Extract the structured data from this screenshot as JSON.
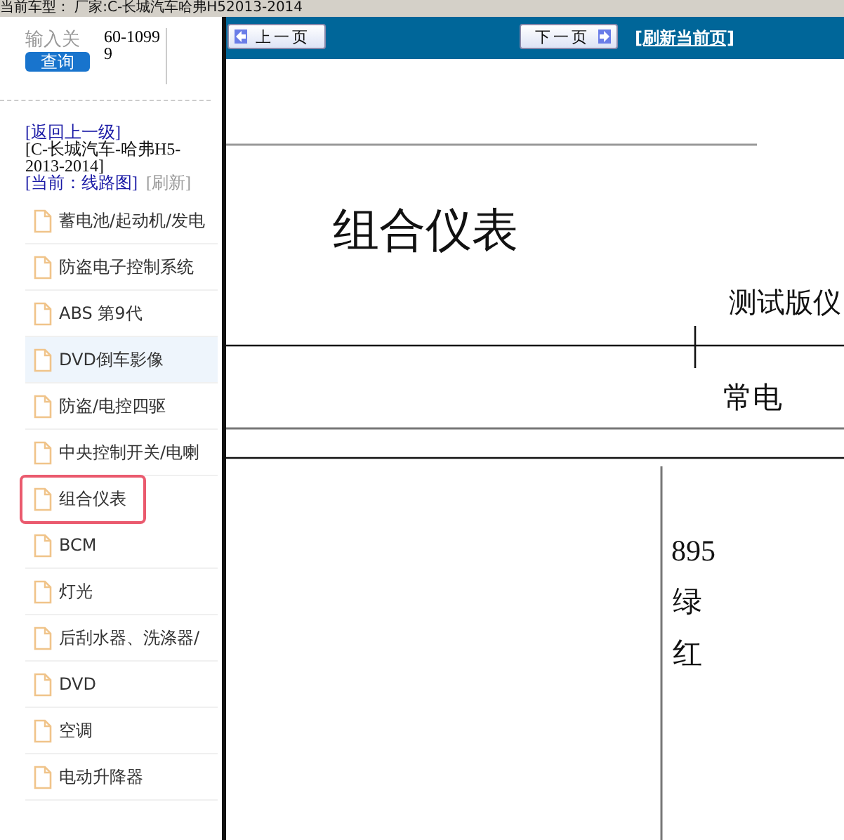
{
  "top_bar": {
    "text": "当前车型：  厂家:C-长城汽车哈弗H52013-2014"
  },
  "search": {
    "placeholder": "输入关",
    "value": "60-10999",
    "button": "查询"
  },
  "breadcrumb": {
    "back": "[返回上一级]",
    "model": "[C-长城汽车-哈弗H5-2013-2014]",
    "current": "[当前：线路图]",
    "refresh": "[刷新]"
  },
  "sidebar": {
    "items": [
      {
        "label": "蓄电池/起动机/发电",
        "selected": false,
        "outlined": false
      },
      {
        "label": "防盗电子控制系统",
        "selected": false,
        "outlined": false
      },
      {
        "label": "ABS 第9代",
        "selected": false,
        "outlined": false
      },
      {
        "label": "DVD倒车影像",
        "selected": true,
        "outlined": false
      },
      {
        "label": "防盗/电控四驱",
        "selected": false,
        "outlined": false
      },
      {
        "label": "中央控制开关/电喇",
        "selected": false,
        "outlined": false
      },
      {
        "label": "组合仪表",
        "selected": false,
        "outlined": true
      },
      {
        "label": "BCM",
        "selected": false,
        "outlined": false
      },
      {
        "label": "灯光",
        "selected": false,
        "outlined": false
      },
      {
        "label": "后刮水器、洗涤器/",
        "selected": false,
        "outlined": false
      },
      {
        "label": "DVD",
        "selected": false,
        "outlined": false
      },
      {
        "label": "空调",
        "selected": false,
        "outlined": false
      },
      {
        "label": "电动升降器",
        "selected": false,
        "outlined": false
      }
    ]
  },
  "pager": {
    "prev": "上一页",
    "next": "下一页",
    "refresh": "[刷新当前页]"
  },
  "diagram": {
    "title": "组合仪表",
    "texts": [
      {
        "text": "测试版仪",
        "kind": "label"
      },
      {
        "text": "常电",
        "kind": "label"
      },
      {
        "text": "895",
        "kind": "wire"
      },
      {
        "text": "绿",
        "kind": "wire"
      },
      {
        "text": "红",
        "kind": "wire"
      }
    ]
  }
}
